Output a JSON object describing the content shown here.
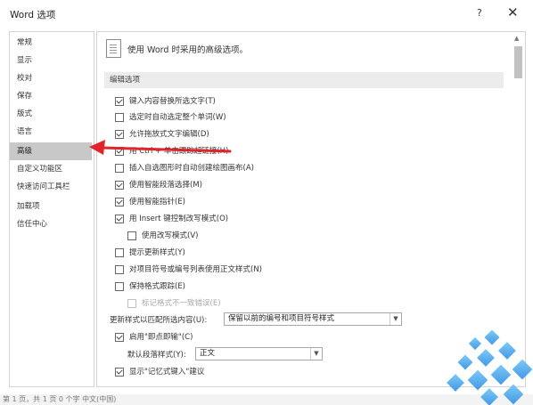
{
  "window": {
    "title": "Word 选项",
    "help": "?",
    "close": "✕"
  },
  "sidebar": {
    "items": [
      {
        "label": "常规"
      },
      {
        "label": "显示"
      },
      {
        "label": "校对"
      },
      {
        "label": "保存"
      },
      {
        "label": "版式"
      },
      {
        "label": "语言"
      },
      {
        "label": "高级",
        "selected": true
      },
      {
        "label": "自定义功能区"
      },
      {
        "label": "快速访问工具栏"
      },
      {
        "label": "加载项"
      },
      {
        "label": "信任中心"
      }
    ]
  },
  "main": {
    "header": "使用 Word 时采用的高级选项。",
    "section": "编辑选项",
    "options": [
      {
        "label": "键入内容替换所选文字(T)",
        "checked": true
      },
      {
        "label": "选定时自动选定整个单词(W)",
        "checked": false
      },
      {
        "label": "允许拖放式文字编辑(D)",
        "checked": true
      },
      {
        "label": "用 Ctrl + 单击跟踪超链接(H)",
        "checked": true
      },
      {
        "label": "插入自选图形时自动创建绘图画布(A)",
        "checked": false
      },
      {
        "label": "使用智能段落选择(M)",
        "checked": true
      },
      {
        "label": "使用智能指针(E)",
        "checked": true
      },
      {
        "label": "用 Insert 键控制改写模式(O)",
        "checked": true
      },
      {
        "label": "使用改写模式(V)",
        "checked": false
      },
      {
        "label": "提示更新样式(Y)",
        "checked": false
      },
      {
        "label": "对项目符号或编号列表使用正文样式(N)",
        "checked": false
      },
      {
        "label": "保持格式跟踪(E)",
        "checked": false
      },
      {
        "label": "标记格式不一致错误(E)",
        "checked": false,
        "disabled": true
      }
    ],
    "update_style": {
      "label": "更新样式以匹配所选内容(U):",
      "value": "保留以前的编号和项目符号样式"
    },
    "smart_cut": {
      "label": "启用\"即点即输\"(C)",
      "checked": true
    },
    "default_para": {
      "label": "默认段落样式(Y):",
      "value": "正文"
    },
    "bottom_cut": {
      "label": "显示\"记忆式键入\"建议",
      "checked": true
    }
  },
  "status": {
    "text": "第 1 页，共 1 页   0 个字   中文(中国)"
  },
  "colors": {
    "selected_bg": "#c8c8c8",
    "arrow": "#e0242a",
    "section_bg": "#ececec"
  }
}
